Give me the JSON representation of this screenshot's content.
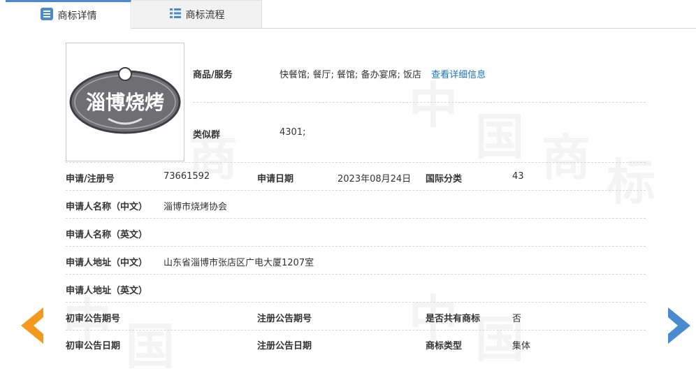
{
  "tabs": [
    {
      "label": "商标详情",
      "icon": "list-detail-icon"
    },
    {
      "label": "商标流程",
      "icon": "list-bullets-icon"
    }
  ],
  "logo": {
    "text": "淄博烧烤"
  },
  "goods": {
    "label": "商品/服务",
    "value": "快餐馆; 餐厅; 餐馆; 备办宴席; 饭店",
    "link": "查看详细信息"
  },
  "similar": {
    "label": "类似群",
    "value": "4301;"
  },
  "reg_no": {
    "label": "申请/注册号",
    "value": "73661592"
  },
  "apply_date": {
    "label": "申请日期",
    "value": "2023年08月24日"
  },
  "intl_class": {
    "label": "国际分类",
    "value": "43"
  },
  "applicant_cn": {
    "label": "申请人名称（中文）",
    "value": "淄博市烧烤协会"
  },
  "applicant_en": {
    "label": "申请人名称（英文）",
    "value": ""
  },
  "address_cn": {
    "label": "申请人地址（中文）",
    "value": "山东省淄博市张店区广电大厦1207室"
  },
  "address_en": {
    "label": "申请人地址（英文）",
    "value": ""
  },
  "prelim_no": {
    "label": "初审公告期号",
    "value": ""
  },
  "reg_pub_no": {
    "label": "注册公告期号",
    "value": ""
  },
  "shared": {
    "label": "是否共有商标",
    "value": "否"
  },
  "prelim_date": {
    "label": "初审公告日期",
    "value": ""
  },
  "reg_pub_date": {
    "label": "注册公告日期",
    "value": ""
  },
  "tm_type": {
    "label": "商标类型",
    "value": "集体"
  },
  "watermark": [
    "中",
    "国",
    "商",
    "标"
  ],
  "colors": {
    "accent": "#4a8ad1",
    "link": "#1a73c9",
    "prev_arrow": "#f39a1e",
    "next_arrow": "#4a8ad1"
  }
}
